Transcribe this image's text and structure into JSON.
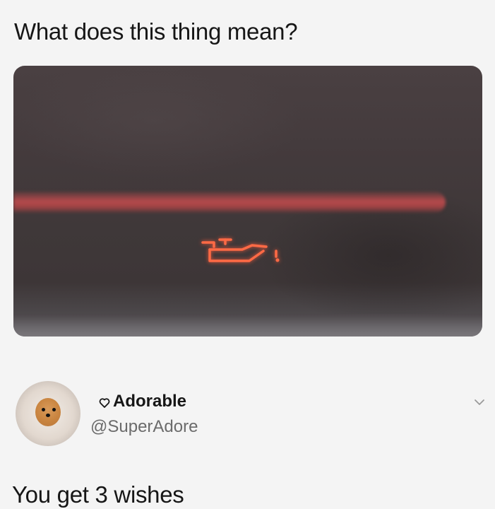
{
  "post": {
    "question": "What does this thing mean?",
    "photo": {
      "subject": "oil-pressure-warning-light",
      "accent_color": "#ff5a3c"
    }
  },
  "reply": {
    "author": {
      "display_name": "Adorable",
      "handle": "@SuperAdore",
      "badge_icon": "heart-icon"
    },
    "text": "You get 3 wishes",
    "menu_icon": "chevron-down-icon"
  },
  "colors": {
    "text": "#161616",
    "muted": "#6b6b6b",
    "background": "#f4f4f4"
  }
}
